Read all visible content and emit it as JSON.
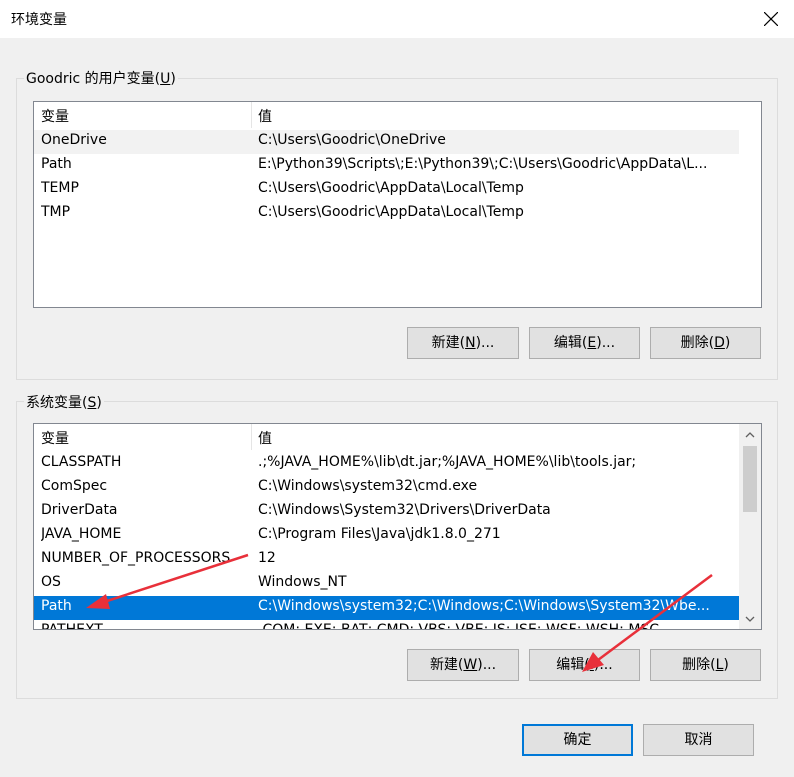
{
  "window": {
    "title": "环境变量"
  },
  "user_vars": {
    "label_pre": "Goodric 的用户变量(",
    "label_key": "U",
    "label_post": ")",
    "col_name": "变量",
    "col_value": "值",
    "rows": [
      {
        "name": "OneDrive",
        "value": "C:\\Users\\Goodric\\OneDrive"
      },
      {
        "name": "Path",
        "value": "E:\\Python39\\Scripts\\;E:\\Python39\\;C:\\Users\\Goodric\\AppData\\L..."
      },
      {
        "name": "TEMP",
        "value": "C:\\Users\\Goodric\\AppData\\Local\\Temp"
      },
      {
        "name": "TMP",
        "value": "C:\\Users\\Goodric\\AppData\\Local\\Temp"
      }
    ],
    "btn_new_pre": "新建(",
    "btn_new_key": "N",
    "btn_new_post": ")...",
    "btn_edit_pre": "编辑(",
    "btn_edit_key": "E",
    "btn_edit_post": ")...",
    "btn_delete_pre": "删除(",
    "btn_delete_key": "D",
    "btn_delete_post": ")"
  },
  "system_vars": {
    "label_pre": "系统变量(",
    "label_key": "S",
    "label_post": ")",
    "col_name": "变量",
    "col_value": "值",
    "rows": [
      {
        "name": "CLASSPATH",
        "value": ".;%JAVA_HOME%\\lib\\dt.jar;%JAVA_HOME%\\lib\\tools.jar;"
      },
      {
        "name": "ComSpec",
        "value": "C:\\Windows\\system32\\cmd.exe"
      },
      {
        "name": "DriverData",
        "value": "C:\\Windows\\System32\\Drivers\\DriverData"
      },
      {
        "name": "JAVA_HOME",
        "value": "C:\\Program Files\\Java\\jdk1.8.0_271"
      },
      {
        "name": "NUMBER_OF_PROCESSORS",
        "value": "12"
      },
      {
        "name": "OS",
        "value": "Windows_NT"
      },
      {
        "name": "Path",
        "value": "C:\\Windows\\system32;C:\\Windows;C:\\Windows\\System32\\Wbe..."
      },
      {
        "name": "PATHEXT",
        "value": ".COM;.EXE;.BAT;.CMD;.VBS;.VBE;.JS;.JSE;.WSF;.WSH;.MSC"
      }
    ],
    "selected_row": "Path",
    "btn_new_pre": "新建(",
    "btn_new_key": "W",
    "btn_new_post": ")...",
    "btn_edit_pre": "编辑(",
    "btn_edit_key": "I",
    "btn_edit_post": ")...",
    "btn_delete_pre": "删除(",
    "btn_delete_key": "L",
    "btn_delete_post": ")"
  },
  "footer": {
    "ok_label": "确定",
    "cancel_label": "取消"
  },
  "colors": {
    "selection": "#0078d7",
    "annotation_arrow": "#e8303a"
  },
  "icons": {
    "close": "close-icon",
    "scroll_up": "chevron-up-icon",
    "scroll_down": "chevron-down-icon",
    "arrow": "annotation-arrow-icon"
  }
}
